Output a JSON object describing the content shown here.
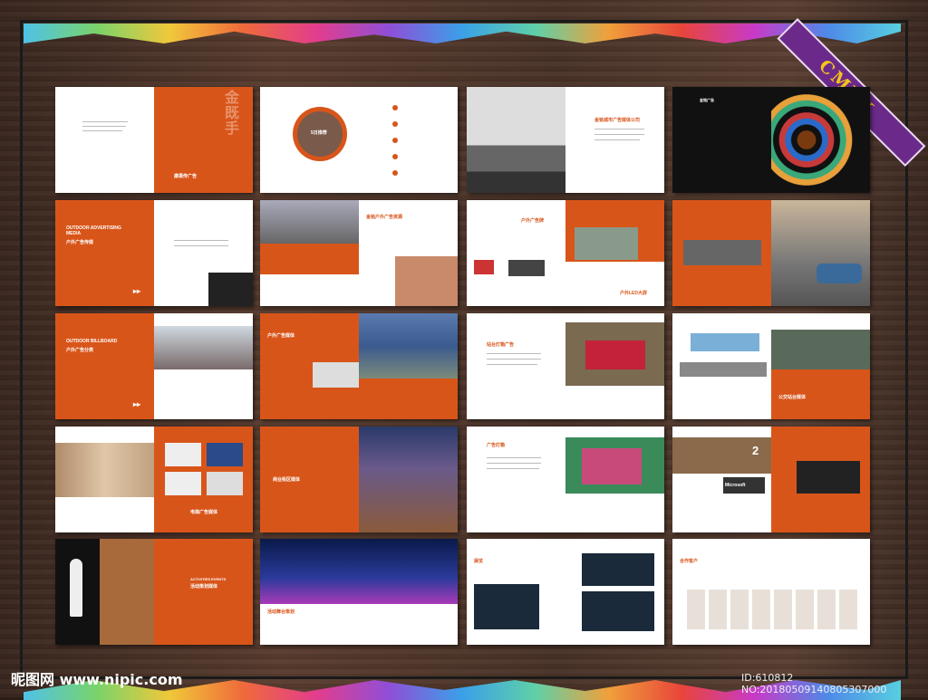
{
  "badge": {
    "text": "CMYK"
  },
  "watermark": {
    "site": "昵图网 www.nipic.com",
    "id": "ID:610812 NO:20180509140805307000"
  },
  "spreads": [
    {
      "cover_char": "金\n既\n手",
      "logo": "康晟传广告"
    },
    {
      "tag": "5日推荐"
    },
    {
      "title": "金铭城市广告媒体公司"
    },
    {
      "title": "金铭广告"
    },
    {
      "title": "OUTDOOR ADVERTISING MEDIA",
      "sub": "户外广告传媒"
    },
    {
      "title": "金铭户外广告资源"
    },
    {
      "title": "户外广告牌"
    },
    {
      "title": "户外LED大屏"
    },
    {
      "title": "OUTDOOR BILLBOARD",
      "sub": "户外广告分类"
    },
    {
      "title": "户外广告媒体"
    },
    {
      "title": "站台灯箱广告"
    },
    {
      "title": "公交站台媒体"
    },
    {
      "title": "电梯广告媒体"
    },
    {
      "title": "商业街区媒体"
    },
    {
      "title": "广告灯箱"
    },
    {
      "title": "Microsoft",
      "num": "2"
    },
    {
      "title": "ACTIVITIES EVENTS",
      "sub": "活动策划媒体"
    },
    {
      "title": "活动舞台策划"
    },
    {
      "title": "展览"
    },
    {
      "title": "合作客户"
    }
  ]
}
